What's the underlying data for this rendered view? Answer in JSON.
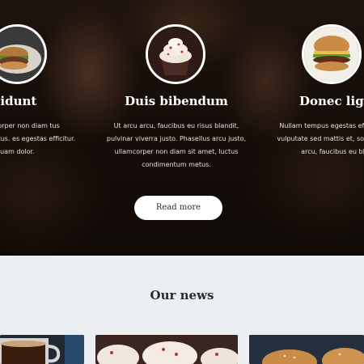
{
  "features": [
    {
      "title": "incidunt",
      "text": "justo, ullamcorper non diam tus condimentum metus. es egestas efficitur. Sed quam dolor.",
      "image_icon": "burger-plate-icon"
    },
    {
      "title": "Duis bibendum",
      "text": "Ut arcu arcu, faucibus eu risus blandit, pulvinar viverra justo. Phasellus arcu justo, ullamcorper non diam sit amet, luctus condimentum metus.",
      "image_icon": "cupcake-icon"
    },
    {
      "title": "Donec ligula",
      "text": "Nullam tempus egestas efficitur. dolor, vulputate sed mattis et, sol orci. Ut arcu arcu, faucibus eu blandit,",
      "image_icon": "burger-icon"
    }
  ],
  "read_more_label": "Read more",
  "news": {
    "title": "Our news",
    "thumbs": [
      "coffee-mug-icon",
      "cupcakes-icon",
      "burgers-icon"
    ]
  },
  "colors": {
    "hero_overlay": "#1b110c",
    "button_bg": "#ffffff",
    "section_bg": "#eceff2",
    "heading_dark": "#2b2b2b"
  }
}
